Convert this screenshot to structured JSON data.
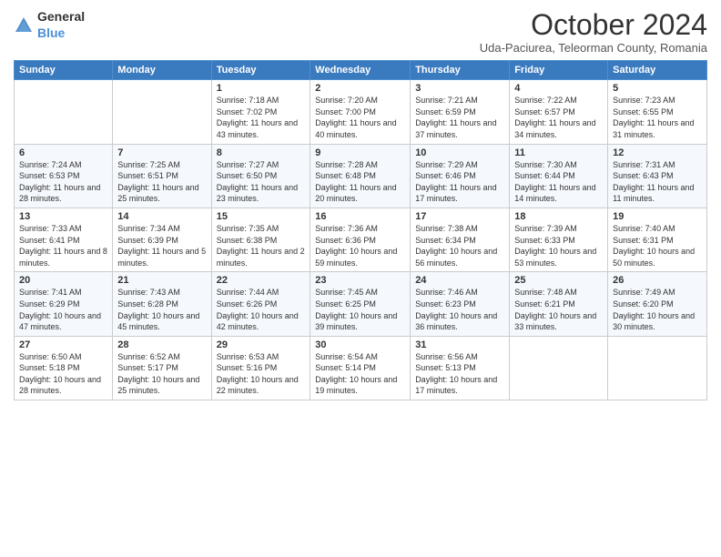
{
  "header": {
    "logo": {
      "general": "General",
      "blue": "Blue"
    },
    "title": "October 2024",
    "subtitle": "Uda-Paciurea, Teleorman County, Romania"
  },
  "calendar": {
    "weekdays": [
      "Sunday",
      "Monday",
      "Tuesday",
      "Wednesday",
      "Thursday",
      "Friday",
      "Saturday"
    ],
    "weeks": [
      [
        {
          "day": "",
          "info": ""
        },
        {
          "day": "",
          "info": ""
        },
        {
          "day": "1",
          "info": "Sunrise: 7:18 AM\nSunset: 7:02 PM\nDaylight: 11 hours and 43 minutes."
        },
        {
          "day": "2",
          "info": "Sunrise: 7:20 AM\nSunset: 7:00 PM\nDaylight: 11 hours and 40 minutes."
        },
        {
          "day": "3",
          "info": "Sunrise: 7:21 AM\nSunset: 6:59 PM\nDaylight: 11 hours and 37 minutes."
        },
        {
          "day": "4",
          "info": "Sunrise: 7:22 AM\nSunset: 6:57 PM\nDaylight: 11 hours and 34 minutes."
        },
        {
          "day": "5",
          "info": "Sunrise: 7:23 AM\nSunset: 6:55 PM\nDaylight: 11 hours and 31 minutes."
        }
      ],
      [
        {
          "day": "6",
          "info": "Sunrise: 7:24 AM\nSunset: 6:53 PM\nDaylight: 11 hours and 28 minutes."
        },
        {
          "day": "7",
          "info": "Sunrise: 7:25 AM\nSunset: 6:51 PM\nDaylight: 11 hours and 25 minutes."
        },
        {
          "day": "8",
          "info": "Sunrise: 7:27 AM\nSunset: 6:50 PM\nDaylight: 11 hours and 23 minutes."
        },
        {
          "day": "9",
          "info": "Sunrise: 7:28 AM\nSunset: 6:48 PM\nDaylight: 11 hours and 20 minutes."
        },
        {
          "day": "10",
          "info": "Sunrise: 7:29 AM\nSunset: 6:46 PM\nDaylight: 11 hours and 17 minutes."
        },
        {
          "day": "11",
          "info": "Sunrise: 7:30 AM\nSunset: 6:44 PM\nDaylight: 11 hours and 14 minutes."
        },
        {
          "day": "12",
          "info": "Sunrise: 7:31 AM\nSunset: 6:43 PM\nDaylight: 11 hours and 11 minutes."
        }
      ],
      [
        {
          "day": "13",
          "info": "Sunrise: 7:33 AM\nSunset: 6:41 PM\nDaylight: 11 hours and 8 minutes."
        },
        {
          "day": "14",
          "info": "Sunrise: 7:34 AM\nSunset: 6:39 PM\nDaylight: 11 hours and 5 minutes."
        },
        {
          "day": "15",
          "info": "Sunrise: 7:35 AM\nSunset: 6:38 PM\nDaylight: 11 hours and 2 minutes."
        },
        {
          "day": "16",
          "info": "Sunrise: 7:36 AM\nSunset: 6:36 PM\nDaylight: 10 hours and 59 minutes."
        },
        {
          "day": "17",
          "info": "Sunrise: 7:38 AM\nSunset: 6:34 PM\nDaylight: 10 hours and 56 minutes."
        },
        {
          "day": "18",
          "info": "Sunrise: 7:39 AM\nSunset: 6:33 PM\nDaylight: 10 hours and 53 minutes."
        },
        {
          "day": "19",
          "info": "Sunrise: 7:40 AM\nSunset: 6:31 PM\nDaylight: 10 hours and 50 minutes."
        }
      ],
      [
        {
          "day": "20",
          "info": "Sunrise: 7:41 AM\nSunset: 6:29 PM\nDaylight: 10 hours and 47 minutes."
        },
        {
          "day": "21",
          "info": "Sunrise: 7:43 AM\nSunset: 6:28 PM\nDaylight: 10 hours and 45 minutes."
        },
        {
          "day": "22",
          "info": "Sunrise: 7:44 AM\nSunset: 6:26 PM\nDaylight: 10 hours and 42 minutes."
        },
        {
          "day": "23",
          "info": "Sunrise: 7:45 AM\nSunset: 6:25 PM\nDaylight: 10 hours and 39 minutes."
        },
        {
          "day": "24",
          "info": "Sunrise: 7:46 AM\nSunset: 6:23 PM\nDaylight: 10 hours and 36 minutes."
        },
        {
          "day": "25",
          "info": "Sunrise: 7:48 AM\nSunset: 6:21 PM\nDaylight: 10 hours and 33 minutes."
        },
        {
          "day": "26",
          "info": "Sunrise: 7:49 AM\nSunset: 6:20 PM\nDaylight: 10 hours and 30 minutes."
        }
      ],
      [
        {
          "day": "27",
          "info": "Sunrise: 6:50 AM\nSunset: 5:18 PM\nDaylight: 10 hours and 28 minutes."
        },
        {
          "day": "28",
          "info": "Sunrise: 6:52 AM\nSunset: 5:17 PM\nDaylight: 10 hours and 25 minutes."
        },
        {
          "day": "29",
          "info": "Sunrise: 6:53 AM\nSunset: 5:16 PM\nDaylight: 10 hours and 22 minutes."
        },
        {
          "day": "30",
          "info": "Sunrise: 6:54 AM\nSunset: 5:14 PM\nDaylight: 10 hours and 19 minutes."
        },
        {
          "day": "31",
          "info": "Sunrise: 6:56 AM\nSunset: 5:13 PM\nDaylight: 10 hours and 17 minutes."
        },
        {
          "day": "",
          "info": ""
        },
        {
          "day": "",
          "info": ""
        }
      ]
    ]
  }
}
